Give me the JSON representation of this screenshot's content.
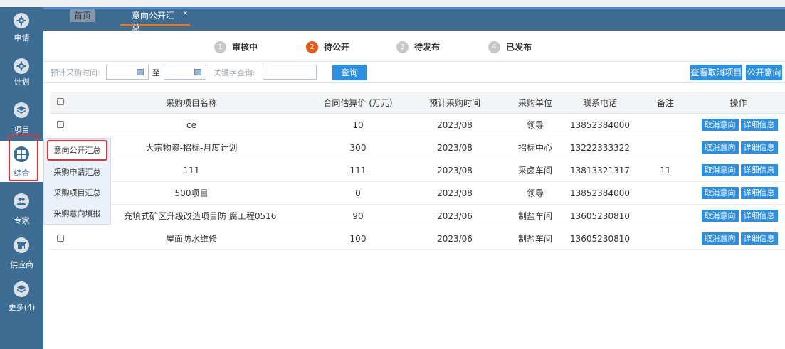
{
  "tabs": {
    "home_label": "首页",
    "active_label": "意向公开汇总",
    "active_close": "×"
  },
  "sidebar": {
    "items": [
      {
        "label": "申请",
        "icon": "gear-icon"
      },
      {
        "label": "计划",
        "icon": "gear-icon"
      },
      {
        "label": "项目",
        "icon": "layers-icon"
      },
      {
        "label": "综合",
        "icon": "grid-icon"
      },
      {
        "label": "专家",
        "icon": "users-icon"
      },
      {
        "label": "供应商",
        "icon": "store-icon"
      },
      {
        "label": "更多(4)",
        "icon": "layers-icon"
      }
    ],
    "selected": "综合"
  },
  "submenu": {
    "items": [
      "意向公开汇总",
      "采购申请汇总",
      "采购项目汇总",
      "采购意向填报"
    ],
    "active": "意向公开汇总"
  },
  "steps": [
    {
      "num": "1",
      "label": "审核中",
      "state": "done"
    },
    {
      "num": "2",
      "label": "待公开",
      "state": "active"
    },
    {
      "num": "3",
      "label": "待发布",
      "state": "todo"
    },
    {
      "num": "4",
      "label": "已发布",
      "state": "todo"
    }
  ],
  "filter": {
    "date_label": "预计采购时间:",
    "to_label": "至",
    "keyword_label": "关键字查询:",
    "search_button": "查询",
    "view_cancelled_button": "查看取消项目",
    "publish_button": "公开意向"
  },
  "table": {
    "headers": [
      "采购项目名称",
      "合同估算价 (万元)",
      "预计采购时间",
      "采购单位",
      "联系电话",
      "备注",
      "操作"
    ],
    "rows": [
      {
        "name": "ce",
        "price": "10",
        "time": "2023/08",
        "unit": "领导",
        "phone": "13852384000",
        "note": ""
      },
      {
        "name": "大宗物资-招标-月度计划",
        "price": "300",
        "time": "2023/08",
        "unit": "招标中心",
        "phone": "13222333322",
        "note": ""
      },
      {
        "name": "111",
        "price": "111",
        "time": "2023/08",
        "unit": "采卤车间",
        "phone": "13813321317",
        "note": "11"
      },
      {
        "name": "500项目",
        "price": "0",
        "time": "2023/08",
        "unit": "领导",
        "phone": "13852384000",
        "note": ""
      },
      {
        "name": "充填式矿区升级改造项目防 腐工程0516",
        "price": "90",
        "time": "2023/06",
        "unit": "制盐车间",
        "phone": "13605230810",
        "note": ""
      },
      {
        "name": "屋面防水维修",
        "price": "100",
        "time": "2023/06",
        "unit": "制盐车间",
        "phone": "13605230810",
        "note": ""
      }
    ],
    "action_cancel": "取消意向",
    "action_detail": "详细信息"
  },
  "colors": {
    "sidebar": "#3e6d93",
    "accent_blue": "#2e8ee0",
    "step_active": "#e85a1c",
    "highlight_red": "#e03232"
  }
}
